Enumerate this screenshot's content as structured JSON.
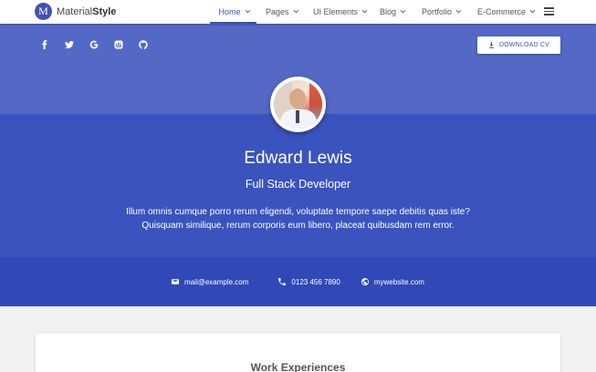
{
  "brand": {
    "logo_letter": "M",
    "name_light": "Material",
    "name_bold": "Style"
  },
  "nav": {
    "items": [
      {
        "label": "Home",
        "active": true
      },
      {
        "label": "Pages"
      },
      {
        "label": "UI Elements"
      },
      {
        "label": "Blog"
      },
      {
        "label": "Portfolio"
      },
      {
        "label": "E-Commerce"
      }
    ]
  },
  "social": [
    "facebook-icon",
    "twitter-icon",
    "google-icon",
    "instagram-icon",
    "github-icon"
  ],
  "download_button": {
    "label": "DOWNLOAD CV"
  },
  "profile": {
    "name": "Edward Lewis",
    "role": "Full Stack Developer",
    "bio_line1": "Illum omnis cumque porro rerum eligendi, voluptate tempore saepe debitis quas iste?",
    "bio_line2": "Quisquam similique, rerum corporis eum libero, placeat quibusdam rem error."
  },
  "contact": {
    "email": "mail@example.com",
    "phone": "0123 456 7890",
    "website": "mywebsite.com"
  },
  "section": {
    "title": "Work Experiences"
  },
  "colors": {
    "accent": "#3f51b5",
    "hero_top": "#5469c6",
    "hero_bottom": "#3a53bf",
    "contact_bar": "#3149b6"
  }
}
